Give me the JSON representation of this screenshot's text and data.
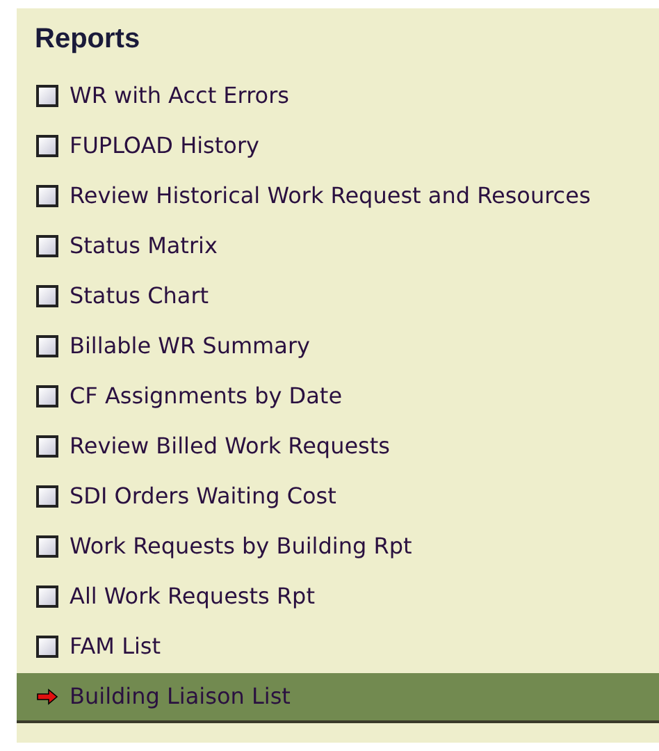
{
  "panel": {
    "title": "Reports",
    "items": [
      {
        "label": "WR with Acct Errors",
        "selected": false
      },
      {
        "label": "FUPLOAD History",
        "selected": false
      },
      {
        "label": "Review Historical Work Request and Resources",
        "selected": false
      },
      {
        "label": "Status Matrix",
        "selected": false
      },
      {
        "label": "Status Chart",
        "selected": false
      },
      {
        "label": "Billable WR Summary",
        "selected": false
      },
      {
        "label": "CF Assignments by Date",
        "selected": false
      },
      {
        "label": "Review Billed Work Requests",
        "selected": false
      },
      {
        "label": "SDI Orders Waiting Cost",
        "selected": false
      },
      {
        "label": "Work Requests by Building Rpt",
        "selected": false
      },
      {
        "label": "All Work Requests Rpt",
        "selected": false
      },
      {
        "label": "FAM List",
        "selected": false
      },
      {
        "label": "Building Liaison List",
        "selected": true
      }
    ]
  }
}
